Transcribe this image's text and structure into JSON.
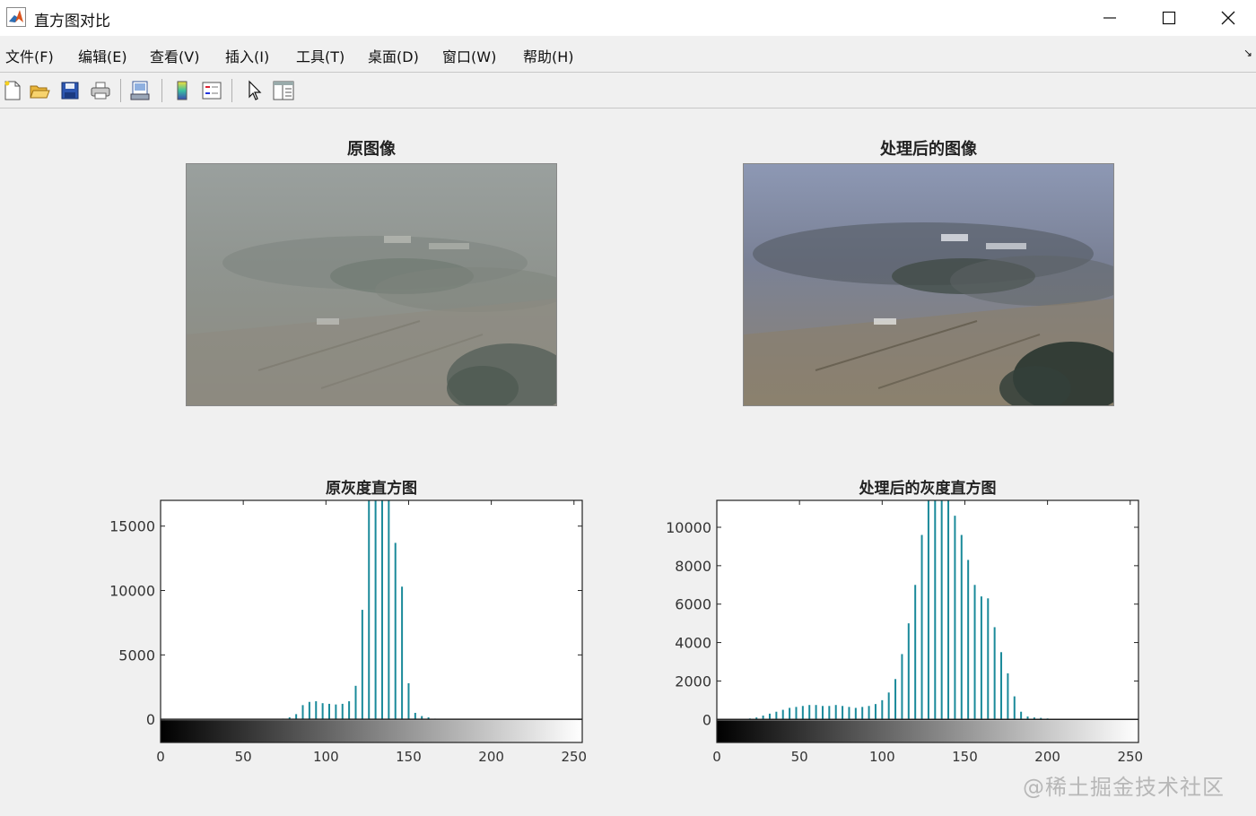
{
  "window": {
    "title": "直方图对比",
    "controls": {
      "minimize": "minimize-icon",
      "maximize": "maximize-icon",
      "close": "close-icon"
    }
  },
  "menu": {
    "items": [
      "文件(F)",
      "编辑(E)",
      "查看(V)",
      "插入(I)",
      "工具(T)",
      "桌面(D)",
      "窗口(W)",
      "帮助(H)"
    ],
    "dock_arrow": "↘"
  },
  "toolbar": {
    "icons": [
      "new-figure-icon",
      "open-file-icon",
      "save-icon",
      "print-icon",
      "link-figure-icon",
      "colorbar-icon",
      "legend-icon",
      "pointer-icon",
      "property-editor-icon"
    ]
  },
  "figure": {
    "images": [
      {
        "title": "原图像",
        "kind": "hazy"
      },
      {
        "title": "处理后的图像",
        "kind": "processed"
      }
    ]
  },
  "chart_data": [
    {
      "type": "bar",
      "title": "原灰度直方图",
      "xlim": [
        0,
        255
      ],
      "ylim": [
        -1800,
        17000
      ],
      "yticks": [
        0,
        5000,
        10000,
        15000
      ],
      "xticks": [
        0,
        50,
        100,
        150,
        200,
        250
      ],
      "color": "#1a8a9a",
      "x": [
        70,
        74,
        78,
        82,
        86,
        90,
        94,
        98,
        102,
        106,
        110,
        114,
        118,
        122,
        126,
        130,
        134,
        138,
        142,
        146,
        150,
        154,
        158,
        162,
        166,
        170,
        174
      ],
      "values": [
        0,
        50,
        150,
        400,
        1100,
        1350,
        1400,
        1250,
        1200,
        1150,
        1200,
        1400,
        2600,
        8500,
        17000,
        17000,
        17000,
        17000,
        13700,
        10300,
        2800,
        500,
        250,
        150,
        50,
        0,
        0
      ]
    },
    {
      "type": "bar",
      "title": "处理后的灰度直方图",
      "xlim": [
        0,
        255
      ],
      "ylim": [
        -1200,
        11400
      ],
      "yticks": [
        0,
        2000,
        4000,
        6000,
        8000,
        10000
      ],
      "xticks": [
        0,
        50,
        100,
        150,
        200,
        250
      ],
      "color": "#1a8a9a",
      "x": [
        20,
        24,
        28,
        32,
        36,
        40,
        44,
        48,
        52,
        56,
        60,
        64,
        68,
        72,
        76,
        80,
        84,
        88,
        92,
        96,
        100,
        104,
        108,
        112,
        116,
        120,
        124,
        128,
        132,
        136,
        140,
        144,
        148,
        152,
        156,
        160,
        164,
        168,
        172,
        176,
        180,
        184,
        188,
        192,
        196,
        200,
        204,
        208,
        212,
        216,
        220
      ],
      "values": [
        50,
        100,
        200,
        300,
        400,
        500,
        600,
        650,
        700,
        750,
        750,
        700,
        700,
        750,
        700,
        650,
        600,
        650,
        700,
        800,
        1000,
        1400,
        2100,
        3400,
        5000,
        7000,
        9600,
        11400,
        11400,
        11400,
        11400,
        10600,
        9600,
        8300,
        7000,
        6400,
        6300,
        4800,
        3500,
        2400,
        1200,
        400,
        150,
        100,
        80,
        50,
        30,
        20,
        10,
        5,
        0
      ]
    }
  ],
  "watermark": "@稀土掘金技术社区"
}
